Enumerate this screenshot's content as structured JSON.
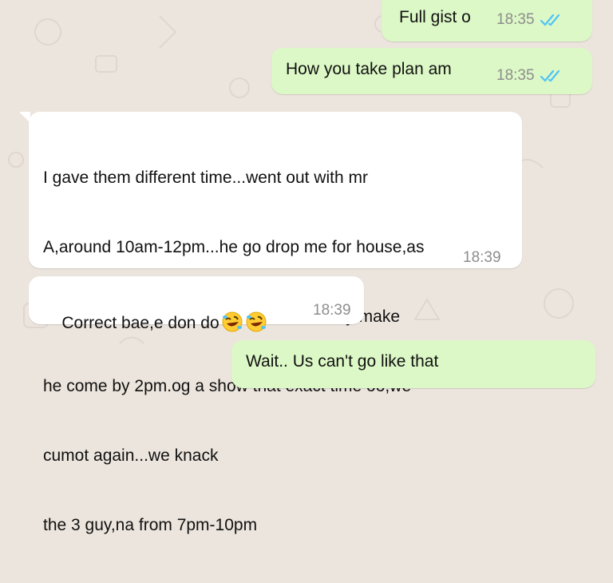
{
  "colors": {
    "background": "#ece5dd",
    "outgoing_bubble": "#dcf8c6",
    "incoming_bubble": "#ffffff",
    "read_ticks": "#4fc3f7",
    "timestamp": "#8d8d8d"
  },
  "messages": [
    {
      "direction": "outgoing",
      "text": "Full gist o",
      "time": "18:35",
      "status_icon": "double-check-read-icon"
    },
    {
      "direction": "outgoing",
      "text": "How you take plan am",
      "time": "18:35",
      "status_icon": "double-check-read-icon"
    },
    {
      "direction": "incoming",
      "lines": [
        "I gave them different time...went out with mr",
        "A,around 10am-12pm...he go drop me for house,as",
        "soon as he drop me,i call mr B,tell am say make",
        "he come by 2pm.og a show that exact time oo,we",
        "cumot again...we knack",
        "the 3 guy,na from 7pm-10pm"
      ],
      "time": "18:39"
    },
    {
      "direction": "incoming",
      "text": "Correct bae,e don do",
      "emoji": [
        "rolling-on-floor-laughing-emoji",
        "rolling-on-floor-laughing-emoji"
      ],
      "time": "18:39"
    },
    {
      "direction": "outgoing",
      "text": "Wait.. Us can't go like that",
      "time": "",
      "partial": true
    }
  ]
}
